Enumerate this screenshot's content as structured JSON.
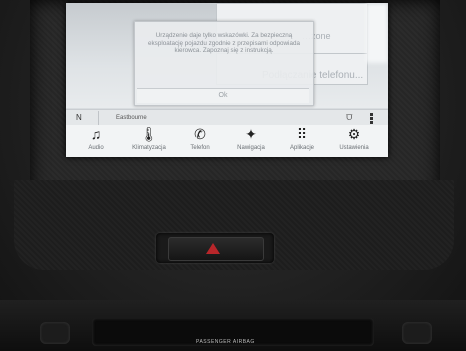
{
  "background": {
    "hint_text": "Podłączanie telefonu...",
    "top_right_text": "…zone"
  },
  "dialog": {
    "message": "Urządzenie daje tylko wskazówki. Za bezpieczną eksploatację pojazdu zgodnie z przepisami odpowiada kierowca. Zapoznaj się z instrukcją.",
    "ok_label": "Ok"
  },
  "status_bar": {
    "compass": "N",
    "location": "Eastbourne"
  },
  "nav": {
    "items": [
      {
        "label": "Audio",
        "icon": "music-note-icon"
      },
      {
        "label": "Klimatyzacja",
        "icon": "thermometer-icon"
      },
      {
        "label": "Telefon",
        "icon": "phone-icon"
      },
      {
        "label": "Nawigacja",
        "icon": "compass-star-icon"
      },
      {
        "label": "Aplikacje",
        "icon": "apps-grid-icon"
      },
      {
        "label": "Ustawienia",
        "icon": "gears-icon"
      }
    ]
  },
  "dash": {
    "airbag_label": "PASSENGER AIRBAG"
  },
  "colors": {
    "hazard": "#b8262a"
  }
}
